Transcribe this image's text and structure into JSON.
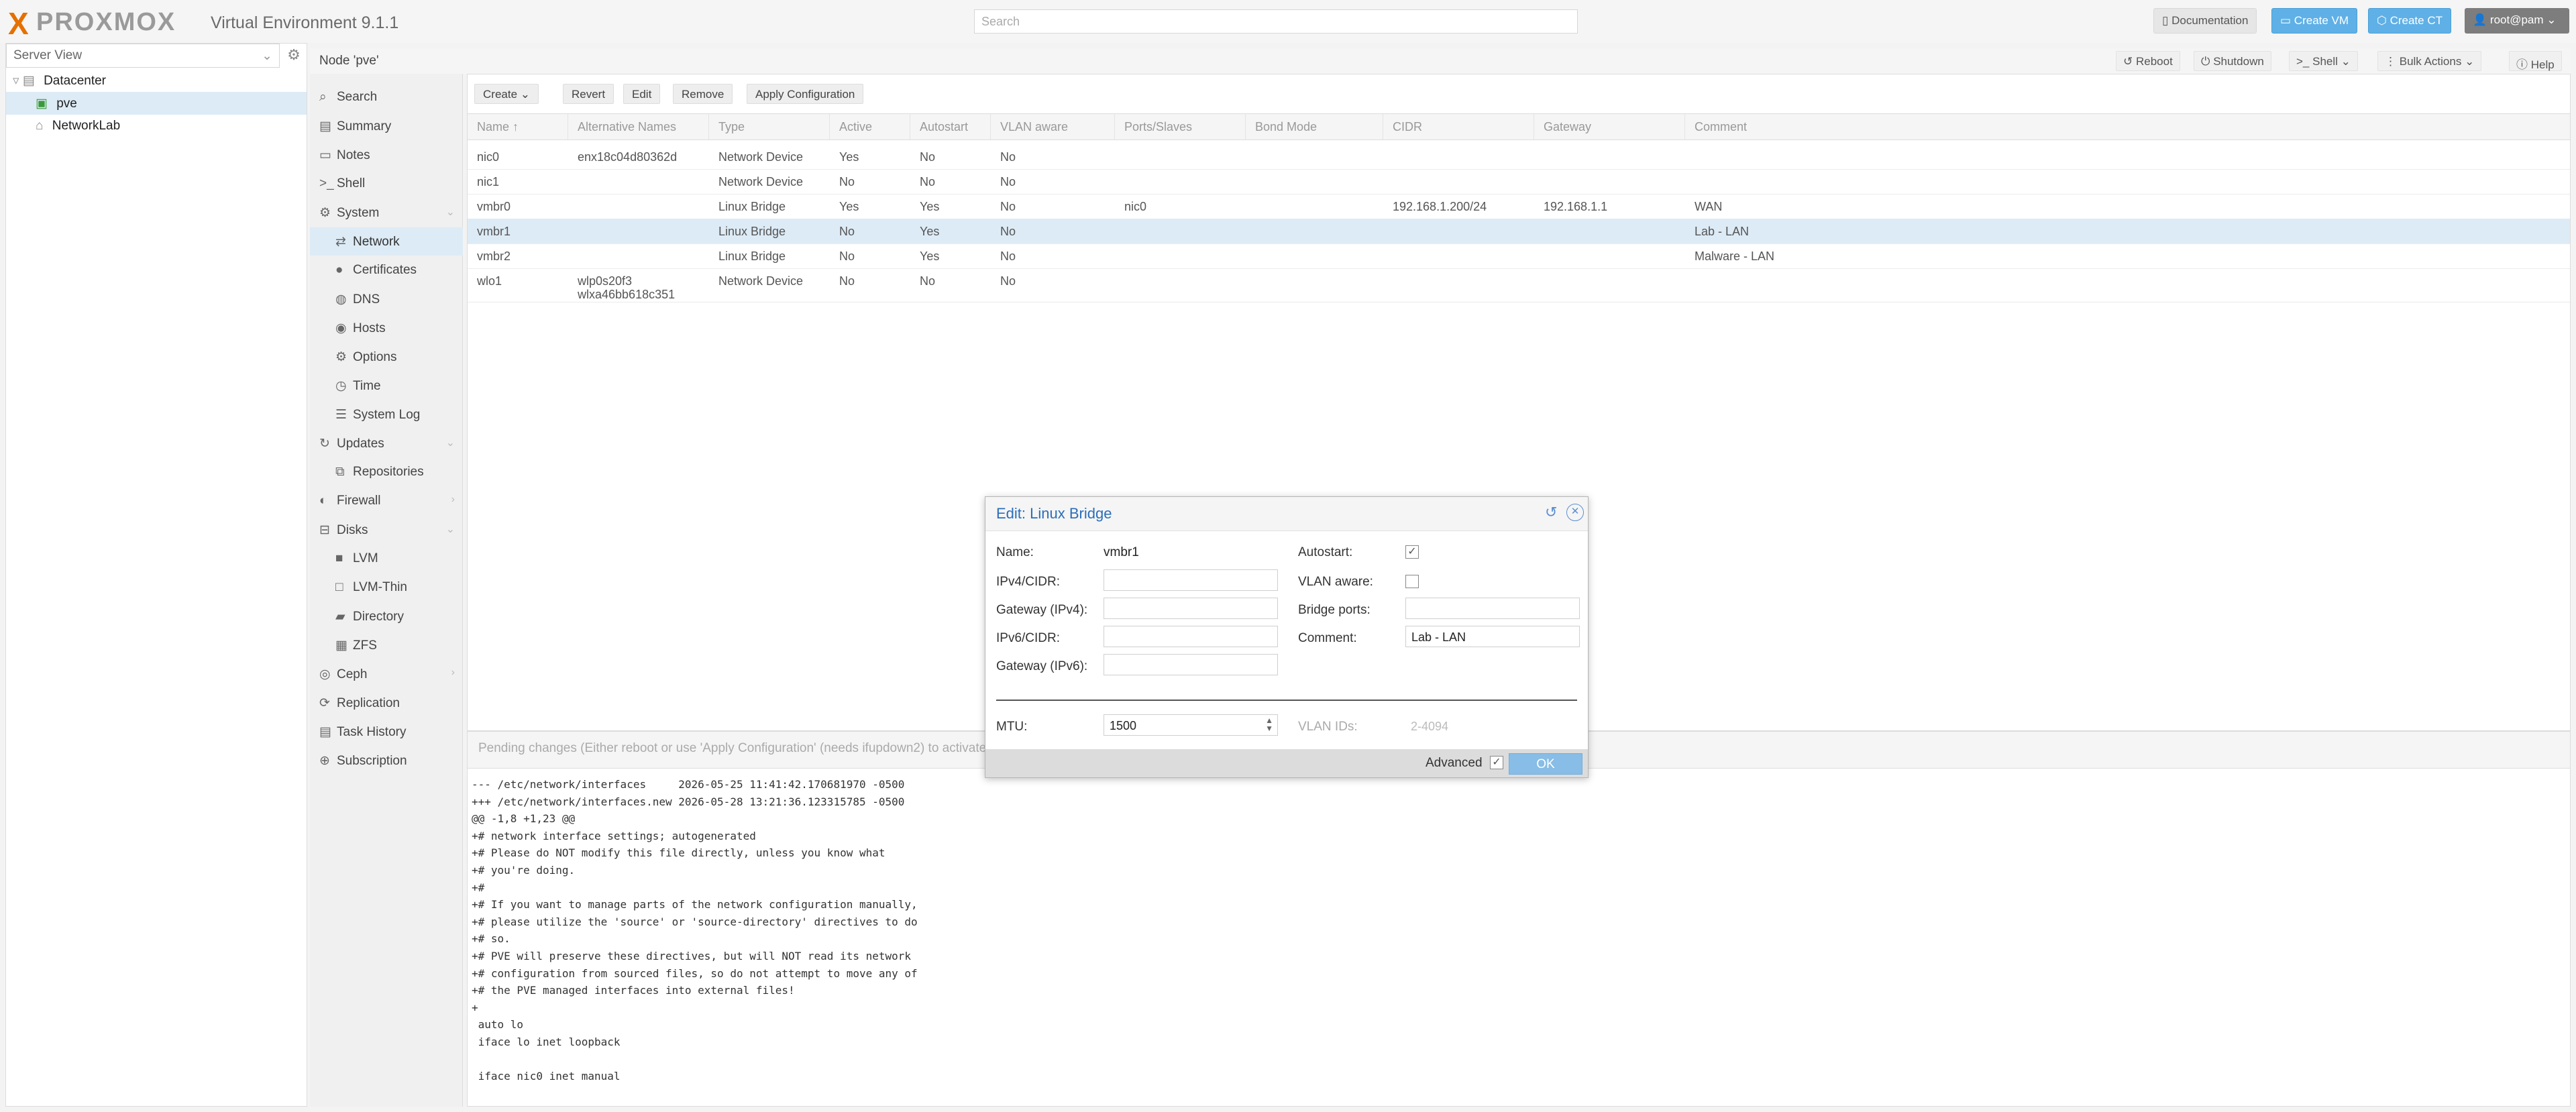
{
  "app": {
    "logo_x": "X",
    "logo_text": "PROXMOX",
    "version": "Virtual Environment 9.1.1",
    "search_placeholder": "Search",
    "buttons": {
      "documentation": "Documentation",
      "create_vm": "Create VM",
      "create_ct": "Create CT",
      "user": "root@pam"
    }
  },
  "tree": {
    "view": "Server View",
    "items": [
      {
        "label": "Datacenter",
        "icon": "datacenter-icon"
      },
      {
        "label": "pve",
        "icon": "node-icon"
      },
      {
        "label": "NetworkLab",
        "icon": "tag-icon"
      }
    ]
  },
  "node": {
    "title": "Node 'pve'",
    "buttons": {
      "reboot": "Reboot",
      "shutdown": "Shutdown",
      "shell": "Shell",
      "bulk": "Bulk Actions",
      "help": "Help"
    }
  },
  "nav": [
    {
      "label": "Search",
      "icon": "⌕"
    },
    {
      "label": "Summary",
      "icon": "▤"
    },
    {
      "label": "Notes",
      "icon": "▭"
    },
    {
      "label": "Shell",
      "icon": ">_"
    },
    {
      "label": "System",
      "icon": "⚙"
    },
    {
      "label": "Network",
      "icon": "⇄"
    },
    {
      "label": "Certificates",
      "icon": "●"
    },
    {
      "label": "DNS",
      "icon": "◍"
    },
    {
      "label": "Hosts",
      "icon": "◉"
    },
    {
      "label": "Options",
      "icon": "⚙"
    },
    {
      "label": "Time",
      "icon": "◷"
    },
    {
      "label": "System Log",
      "icon": "☰"
    },
    {
      "label": "Updates",
      "icon": "↻"
    },
    {
      "label": "Repositories",
      "icon": "⧉"
    },
    {
      "label": "Firewall",
      "icon": "◐"
    },
    {
      "label": "Disks",
      "icon": "⊟"
    },
    {
      "label": "LVM",
      "icon": "■"
    },
    {
      "label": "LVM-Thin",
      "icon": "□"
    },
    {
      "label": "Directory",
      "icon": "▰"
    },
    {
      "label": "ZFS",
      "icon": "▦"
    },
    {
      "label": "Ceph",
      "icon": "◎"
    },
    {
      "label": "Replication",
      "icon": "⟳"
    },
    {
      "label": "Task History",
      "icon": "▤"
    },
    {
      "label": "Subscription",
      "icon": "⊕"
    }
  ],
  "grid": {
    "toolbar": {
      "create": "Create",
      "revert": "Revert",
      "edit": "Edit",
      "remove": "Remove",
      "apply": "Apply Configuration"
    },
    "columns": [
      "Name ↑",
      "Alternative Names",
      "Type",
      "Active",
      "Autostart",
      "VLAN aware",
      "Ports/Slaves",
      "Bond Mode",
      "CIDR",
      "Gateway",
      "Comment"
    ],
    "rows": [
      {
        "name": "nic0",
        "alt": "enx18c04d80362d",
        "alt2": "",
        "type": "Network Device",
        "active": "Yes",
        "autostart": "No",
        "vlan": "No",
        "ports": "",
        "bond": "",
        "cidr": "",
        "gateway": "",
        "comment": ""
      },
      {
        "name": "nic1",
        "alt": "",
        "alt2": "",
        "type": "Network Device",
        "active": "No",
        "autostart": "No",
        "vlan": "No",
        "ports": "",
        "bond": "",
        "cidr": "",
        "gateway": "",
        "comment": ""
      },
      {
        "name": "vmbr0",
        "alt": "",
        "alt2": "",
        "type": "Linux Bridge",
        "active": "Yes",
        "autostart": "Yes",
        "vlan": "No",
        "ports": "nic0",
        "bond": "",
        "cidr": "192.168.1.200/24",
        "gateway": "192.168.1.1",
        "comment": "WAN"
      },
      {
        "name": "vmbr1",
        "alt": "",
        "alt2": "",
        "type": "Linux Bridge",
        "active": "No",
        "autostart": "Yes",
        "vlan": "No",
        "ports": "",
        "bond": "",
        "cidr": "",
        "gateway": "",
        "comment": "Lab - LAN"
      },
      {
        "name": "vmbr2",
        "alt": "",
        "alt2": "",
        "type": "Linux Bridge",
        "active": "No",
        "autostart": "Yes",
        "vlan": "No",
        "ports": "",
        "bond": "",
        "cidr": "",
        "gateway": "",
        "comment": "Malware - LAN"
      },
      {
        "name": "wlo1",
        "alt": "wlp0s20f3",
        "alt2": "wlxa46bb618c351",
        "type": "Network Device",
        "active": "No",
        "autostart": "No",
        "vlan": "No",
        "ports": "",
        "bond": "",
        "cidr": "",
        "gateway": "",
        "comment": ""
      }
    ]
  },
  "pending": {
    "title": "Pending changes (Either reboot or use 'Apply Configuration' (needs ifupdown2) to activate)",
    "diff": "--- /etc/network/interfaces     2026-05-25 11:41:42.170681970 -0500\n+++ /etc/network/interfaces.new 2026-05-28 13:21:36.123315785 -0500\n@@ -1,8 +1,23 @@\n+# network interface settings; autogenerated\n+# Please do NOT modify this file directly, unless you know what\n+# you're doing.\n+#\n+# If you want to manage parts of the network configuration manually,\n+# please utilize the 'source' or 'source-directory' directives to do\n+# so.\n+# PVE will preserve these directives, but will NOT read its network\n+# configuration from sourced files, so do not attempt to move any of\n+# the PVE managed interfaces into external files!\n+\n auto lo\n iface lo inet loopback\n\n iface nic0 inet manual"
  },
  "modal": {
    "title": "Edit: Linux Bridge",
    "name_label": "Name:",
    "name_value": "vmbr1",
    "ipv4_label": "IPv4/CIDR:",
    "ipv4_value": "",
    "gw4_label": "Gateway (IPv4):",
    "gw4_value": "",
    "ipv6_label": "IPv6/CIDR:",
    "ipv6_value": "",
    "gw6_label": "Gateway (IPv6):",
    "gw6_value": "",
    "autostart_label": "Autostart:",
    "autostart_checked": true,
    "vlan_label": "VLAN aware:",
    "vlan_checked": false,
    "ports_label": "Bridge ports:",
    "ports_value": "",
    "comment_label": "Comment:",
    "comment_value": "Lab - LAN",
    "mtu_label": "MTU:",
    "mtu_value": "1500",
    "vlanids_label": "VLAN IDs:",
    "vlanids_placeholder": "2-4094",
    "advanced_label": "Advanced",
    "advanced_checked": true,
    "ok": "OK"
  },
  "colors": {
    "accent": "#e57000",
    "selection": "#ddebf6",
    "button_blue": "#5fb0e6",
    "title_blue": "#2a6eba"
  }
}
